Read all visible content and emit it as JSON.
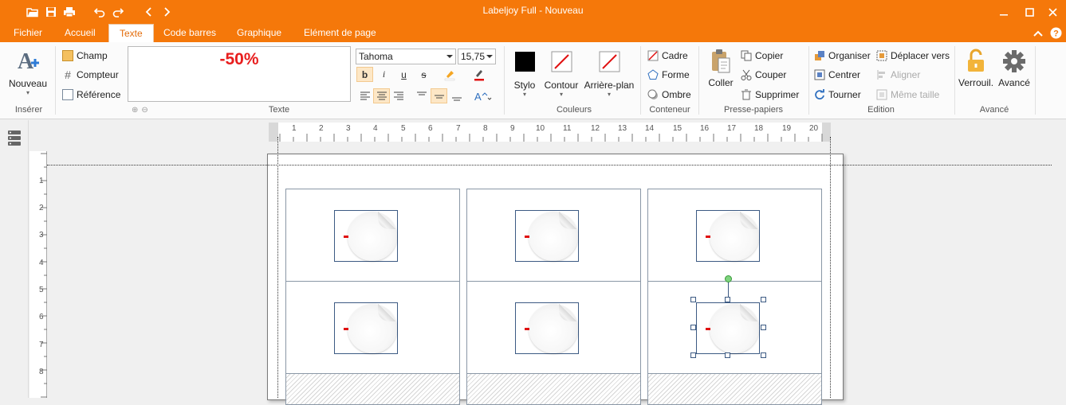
{
  "window": {
    "title": "Labeljoy Full - Nouveau"
  },
  "tabs": [
    {
      "label": "Fichier"
    },
    {
      "label": "Accueil"
    },
    {
      "label": "Texte",
      "active": true
    },
    {
      "label": "Code barres"
    },
    {
      "label": "Graphique"
    },
    {
      "label": "Elément de page"
    }
  ],
  "ribbon": {
    "inserer": {
      "label": "Insérer",
      "nouveau": "Nouveau"
    },
    "texte": {
      "label": "Texte",
      "champ": "Champ",
      "compteur": "Compteur",
      "reference": "Référence",
      "preview_text": "-50%",
      "font_name": "Tahoma",
      "font_size": "15,75"
    },
    "couleurs": {
      "label": "Couleurs",
      "stylo": "Stylo",
      "contour": "Contour",
      "arriere_plan": "Arrière-plan"
    },
    "conteneur": {
      "label": "Conteneur",
      "cadre": "Cadre",
      "forme": "Forme",
      "ombre": "Ombre"
    },
    "presse_papiers": {
      "label": "Presse-papiers",
      "coller": "Coller",
      "copier": "Copier",
      "couper": "Couper",
      "supprimer": "Supprimer"
    },
    "edition": {
      "label": "Edition",
      "organiser": "Organiser",
      "centrer": "Centrer",
      "tourner": "Tourner",
      "deplacer_vers": "Déplacer vers",
      "aligner": "Aligner",
      "meme_taille": "Même taille"
    },
    "avance": {
      "label": "Avancé",
      "verrouil": "Verrouil.",
      "avance": "Avancé"
    }
  },
  "ruler": {
    "h": [
      "1",
      "2",
      "3",
      "4",
      "5",
      "6",
      "7",
      "8",
      "9",
      "10",
      "11",
      "12",
      "13",
      "14",
      "15",
      "16",
      "17",
      "18",
      "19",
      "20"
    ],
    "v": [
      "1",
      "2",
      "3",
      "4",
      "5",
      "6",
      "7",
      "8"
    ]
  },
  "colors": {
    "accent": "#f5780a",
    "text_red": "#e81e1e"
  }
}
